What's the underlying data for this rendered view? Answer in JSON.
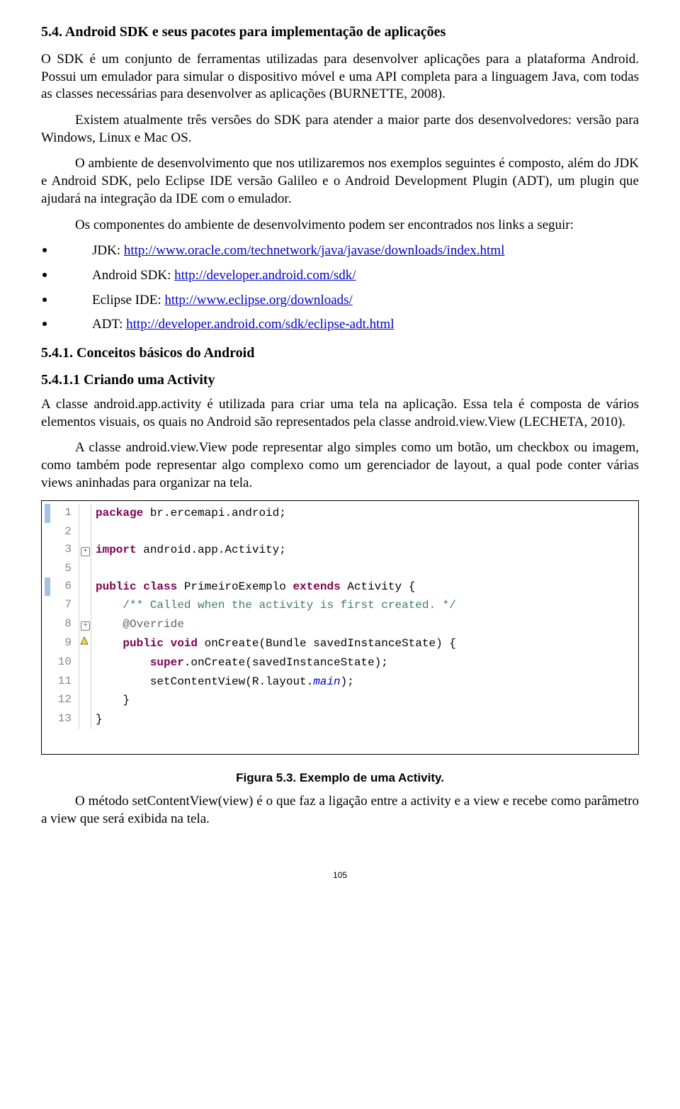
{
  "heading_5_4": "5.4. Android SDK e seus pacotes para implementação de aplicações",
  "p1": "O SDK é um conjunto de ferramentas utilizadas para desenvolver aplicações para a plataforma Android. Possui um emulador para simular o dispositivo móvel e uma API completa para a linguagem Java, com todas as classes necessárias para desenvolver as aplicações (BURNETTE, 2008).",
  "p2": "Existem atualmente três versões do SDK para atender a maior parte dos desenvolvedores: versão para Windows, Linux e Mac OS.",
  "p3": "O ambiente de desenvolvimento que nos utilizaremos nos exemplos seguintes é composto, além do JDK e Android SDK, pelo Eclipse IDE versão Galileo e o Android Development Plugin (ADT), um plugin que ajudará na integração da IDE com o emulador.",
  "p4": "Os componentes do ambiente de desenvolvimento podem ser encontrados nos links a seguir:",
  "links": [
    {
      "label": "JDK: ",
      "url_text": "http://www.oracle.com/technetwork/java/javase/downloads/index.html"
    },
    {
      "label": "Android SDK: ",
      "url_text": "http://developer.android.com/sdk/"
    },
    {
      "label": "Eclipse IDE: ",
      "url_text": "http://www.eclipse.org/downloads/"
    },
    {
      "label": "ADT: ",
      "url_text": "http://developer.android.com/sdk/eclipse-adt.html"
    }
  ],
  "heading_5_4_1": "5.4.1. Conceitos básicos do Android",
  "heading_5_4_1_1": "5.4.1.1 Criando uma Activity",
  "p5": "A classe android.app.activity é utilizada para criar uma tela na aplicação. Essa tela é composta de vários elementos visuais, os quais no Android são representados pela classe android.view.View (LECHETA, 2010).",
  "p6": "A classe android.view.View pode representar algo simples como um botão, um checkbox ou imagem, como também pode representar algo complexo como um gerenciador de layout, a qual pode conter várias views aninhadas para organizar na tela.",
  "code": {
    "lines": [
      {
        "n": "1",
        "gutter": "blue",
        "margin": "",
        "html": "<span class='kw-purple'>package</span> br.ercemapi.android;"
      },
      {
        "n": "2",
        "gutter": "white",
        "margin": "",
        "html": ""
      },
      {
        "n": "3",
        "gutter": "white",
        "margin": "expand",
        "html": "<span class='kw-purple'>import</span> android.app.Activity;"
      },
      {
        "n": "5",
        "gutter": "white",
        "margin": "",
        "html": ""
      },
      {
        "n": "6",
        "gutter": "blue",
        "margin": "",
        "html": "<span class='kw-purple'>public class</span> PrimeiroExemplo <span class='kw-purple'>extends</span> Activity {"
      },
      {
        "n": "7",
        "gutter": "white",
        "margin": "",
        "html": "    <span class='kw-green'>/** Called when the activity is first created. */</span>"
      },
      {
        "n": "8",
        "gutter": "white",
        "margin": "expand",
        "html": "    <span class='kw-gray'>@Override</span>"
      },
      {
        "n": "9",
        "gutter": "white",
        "margin": "warn",
        "html": "    <span class='kw-purple'>public void</span> onCreate(Bundle savedInstanceState) {"
      },
      {
        "n": "10",
        "gutter": "white",
        "margin": "",
        "html": "        <span class='kw-purple'>super</span>.onCreate(savedInstanceState);"
      },
      {
        "n": "11",
        "gutter": "white",
        "margin": "",
        "html": "        setContentView(R.layout.<span class='kw-blue'>main</span>);"
      },
      {
        "n": "12",
        "gutter": "white",
        "margin": "",
        "html": "    }"
      },
      {
        "n": "13",
        "gutter": "white",
        "margin": "",
        "html": "}"
      }
    ]
  },
  "caption": "Figura 5.3. Exemplo de uma Activity.",
  "p7": "O método setContentView(view) é o que faz a ligação entre a activity e a view e recebe como parâmetro a view que será exibida na tela.",
  "page_number": "105"
}
